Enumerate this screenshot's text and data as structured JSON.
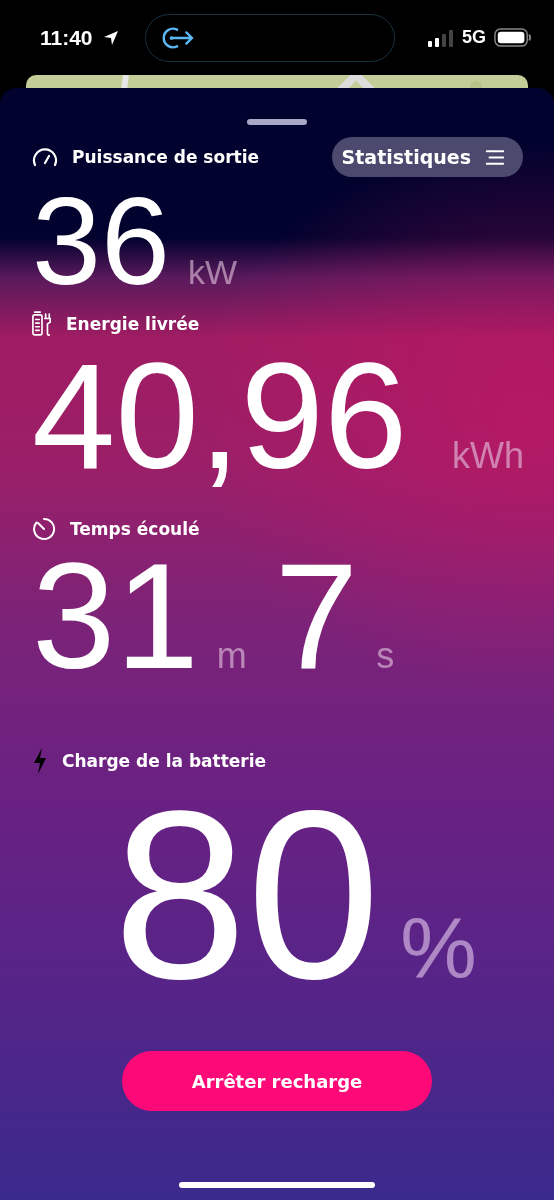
{
  "status_bar": {
    "time": "11:40",
    "network": "5G"
  },
  "sheet": {
    "stats_button": "Statistiques",
    "metrics": [
      {
        "kind": "gauge",
        "label": "Puissance de sortie",
        "parts": [
          {
            "value": "36",
            "unit": "kW"
          }
        ]
      },
      {
        "kind": "charger",
        "label": "Energie livrée",
        "parts": [
          {
            "value": "40,96",
            "unit": "kWh"
          }
        ]
      },
      {
        "kind": "timer",
        "label": "Temps écoulé",
        "parts": [
          {
            "value": "31",
            "unit": "m"
          },
          {
            "value": "7",
            "unit": "s"
          }
        ]
      }
    ],
    "battery": {
      "kind": "bolt",
      "label": "Charge de la batterie",
      "value": "80",
      "unit": "%"
    },
    "stop_button": "Arrêter recharge"
  }
}
